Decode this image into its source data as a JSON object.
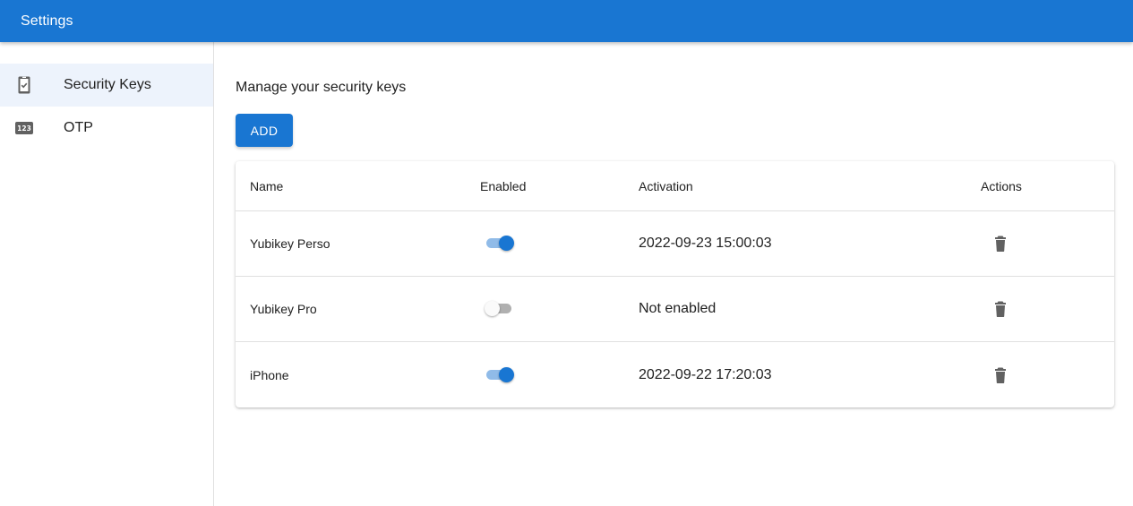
{
  "appbar": {
    "title": "Settings"
  },
  "colors": {
    "primary": "#1976d2",
    "selected_bg": "#edf3fc",
    "icon_gray": "#616161"
  },
  "sidebar": {
    "items": [
      {
        "label": "Security Keys",
        "icon": "security-key-icon",
        "selected": true
      },
      {
        "label": "OTP",
        "icon": "numbers-123-icon",
        "selected": false
      }
    ]
  },
  "main": {
    "heading": "Manage your security keys",
    "add_label": "ADD",
    "table": {
      "headers": {
        "name": "Name",
        "enabled": "Enabled",
        "activation": "Activation",
        "actions": "Actions"
      },
      "rows": [
        {
          "name": "Yubikey Perso",
          "enabled": true,
          "activation": "2022-09-23 15:00:03",
          "action_icon": "trash-icon"
        },
        {
          "name": "Yubikey Pro",
          "enabled": false,
          "activation": "Not enabled",
          "action_icon": "trash-icon"
        },
        {
          "name": "iPhone",
          "enabled": true,
          "activation": "2022-09-22 17:20:03",
          "action_icon": "trash-icon"
        }
      ]
    }
  }
}
